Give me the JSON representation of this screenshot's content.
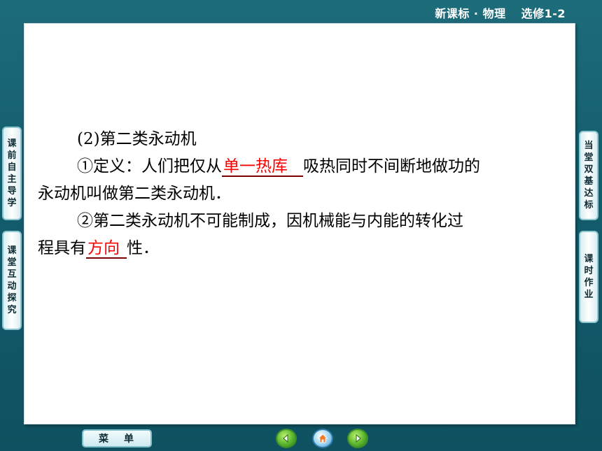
{
  "header": {
    "course": "新课标 · 物理",
    "module": "选修1-2"
  },
  "left_tabs": [
    {
      "label": "课前自主导学"
    },
    {
      "label": "课堂互动探究"
    }
  ],
  "right_tabs": [
    {
      "label": "当堂双基达标"
    },
    {
      "label": "课时作业"
    }
  ],
  "content": {
    "heading": "(2)第二类永动机",
    "definition_prefix": "①定义：人们把仅从",
    "definition_blank": "单一热库",
    "definition_suffix": "吸热同时不间断地做功的",
    "definition_line2": "永动机叫做第二类永动机．",
    "reason_line1": "②第二类永动机不可能制成，因机械能与内能的转化过",
    "reason_prefix": "程具有",
    "reason_blank": "方向",
    "reason_suffix": "性．"
  },
  "bottom_bar": {
    "menu_label": "菜单",
    "nav_icons": [
      "previous-icon",
      "home-icon",
      "next-icon"
    ]
  },
  "colors": {
    "background": "#135d6d",
    "blank_text": "#ff0000",
    "tab_border": "#8cc6d0"
  }
}
